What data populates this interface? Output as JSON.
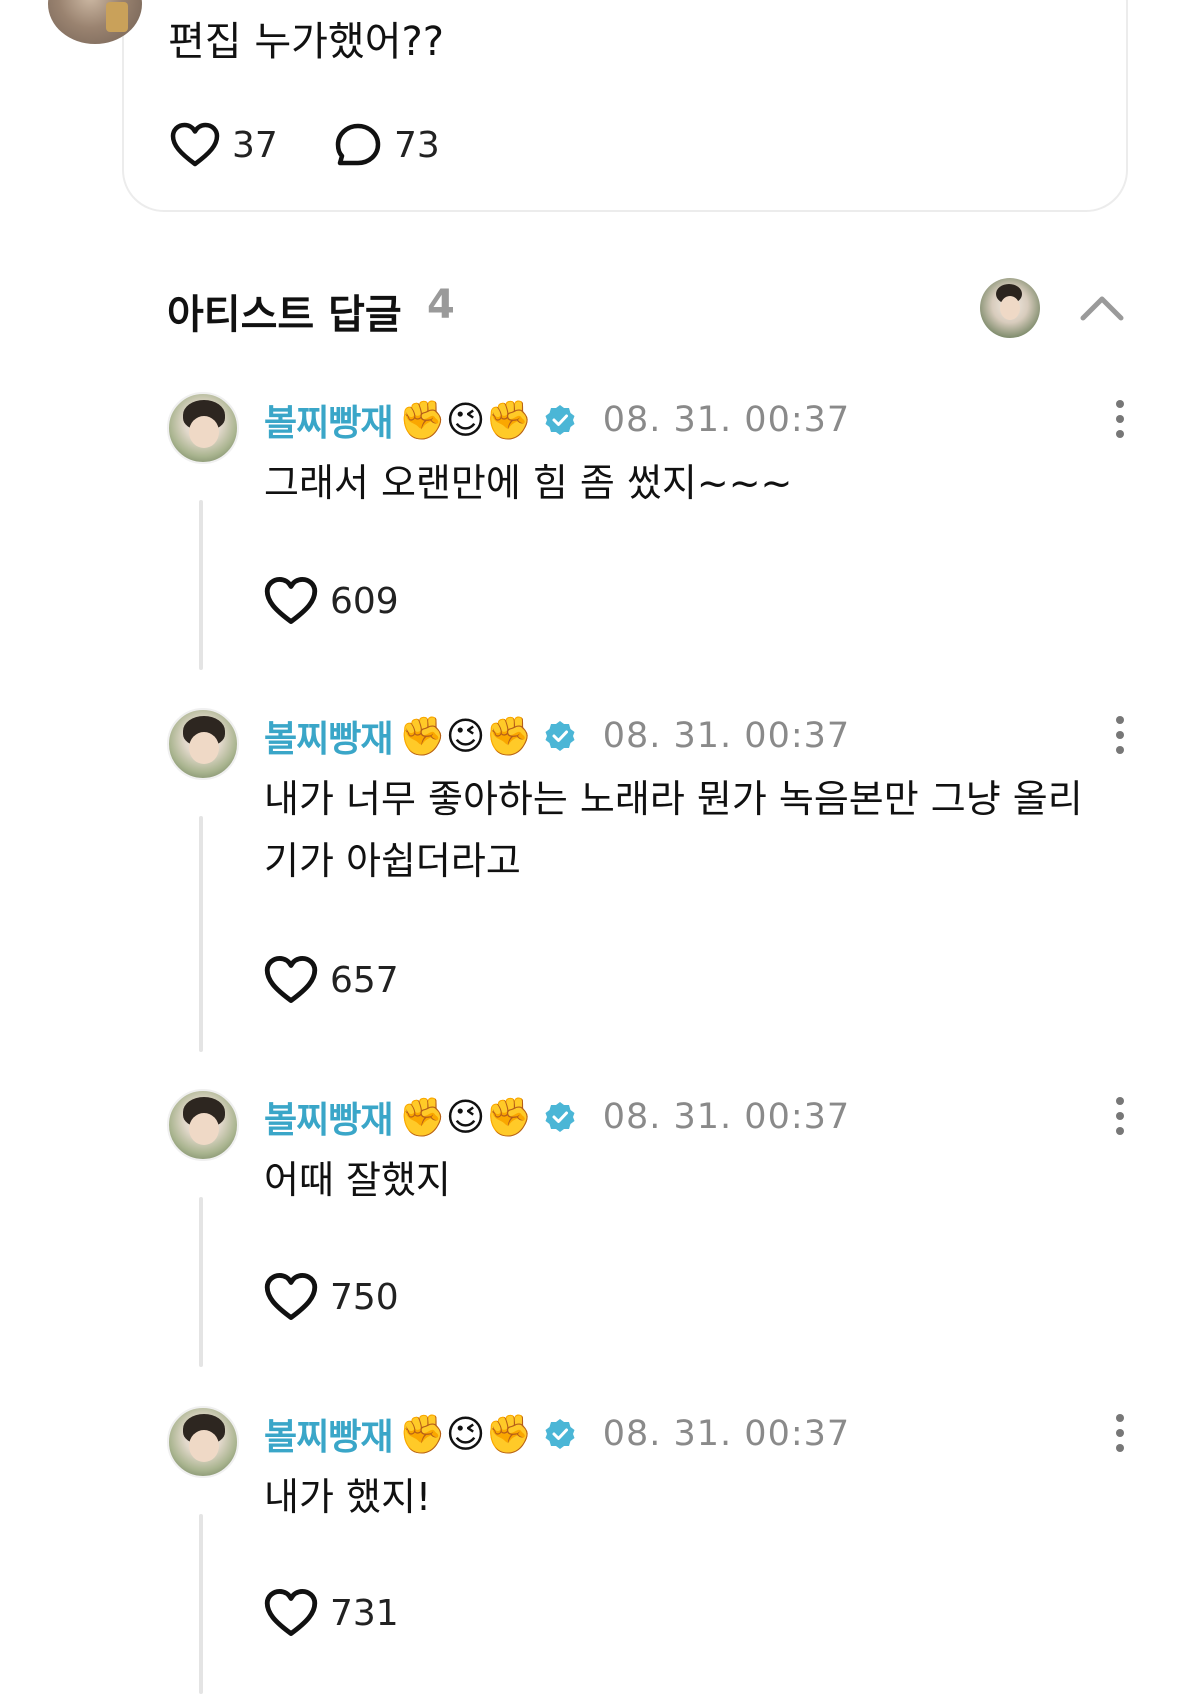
{
  "post": {
    "text": "편집 누가했어??",
    "like_count": "37",
    "comment_count": "73"
  },
  "section": {
    "title": "아티스트 답글",
    "count": "4"
  },
  "replies": [
    {
      "author": "볼찌빵재",
      "emojis": "✊😉✊",
      "timestamp": "08. 31. 00:37",
      "text": "그래서 오랜만에 힘 좀 썼지~~~",
      "likes": "609"
    },
    {
      "author": "볼찌빵재",
      "emojis": "✊😉✊",
      "timestamp": "08. 31. 00:37",
      "text": "내가 너무 좋아하는 노래라 뭔가 녹음본만 그냥 올리기가 아쉽더라고",
      "likes": "657"
    },
    {
      "author": "볼찌빵재",
      "emojis": "✊😉✊",
      "timestamp": "08. 31. 00:37",
      "text": "어때 잘했지",
      "likes": "750"
    },
    {
      "author": "볼찌빵재",
      "emojis": "✊😉✊",
      "timestamp": "08. 31. 00:37",
      "text": "내가 했지!",
      "likes": "731"
    }
  ],
  "colors": {
    "author": "#3aa6c8",
    "verified": "#4bb6d6",
    "muted": "#8a8a8a"
  },
  "icons": [
    "heart-icon",
    "comment-bubble-icon",
    "verified-badge-icon",
    "chevron-up-icon",
    "more-vertical-icon"
  ]
}
